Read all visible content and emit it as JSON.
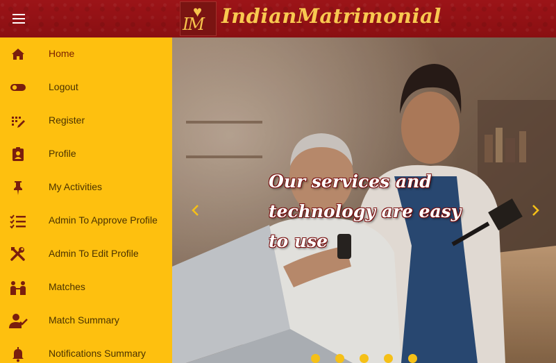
{
  "header": {
    "logo_text": "IM",
    "brand": "IndianMatrimonial",
    "menu_icon": "hamburger-icon",
    "background_color": "#8f1114",
    "brand_color": "#f8c850"
  },
  "sidebar": {
    "background_color": "#fec00f",
    "items": [
      {
        "label": "Home",
        "icon": "home-icon"
      },
      {
        "label": "Logout",
        "icon": "toggle-icon"
      },
      {
        "label": "Register",
        "icon": "register-icon"
      },
      {
        "label": "Profile",
        "icon": "profile-card-icon"
      },
      {
        "label": "My Activities",
        "icon": "pin-icon"
      },
      {
        "label": "Admin To Approve Profile",
        "icon": "checklist-icon"
      },
      {
        "label": "Admin To Edit Profile",
        "icon": "tools-icon"
      },
      {
        "label": "Matches",
        "icon": "people-match-icon"
      },
      {
        "label": "Match Summary",
        "icon": "user-check-icon"
      },
      {
        "label": "Notifications Summary",
        "icon": "bell-icon"
      }
    ]
  },
  "carousel": {
    "caption": "Our services and technology are easy to use",
    "prev_icon": "chevron-left-icon",
    "next_icon": "chevron-right-icon",
    "slide_count": 5,
    "indicator_color": "#f5c017"
  }
}
